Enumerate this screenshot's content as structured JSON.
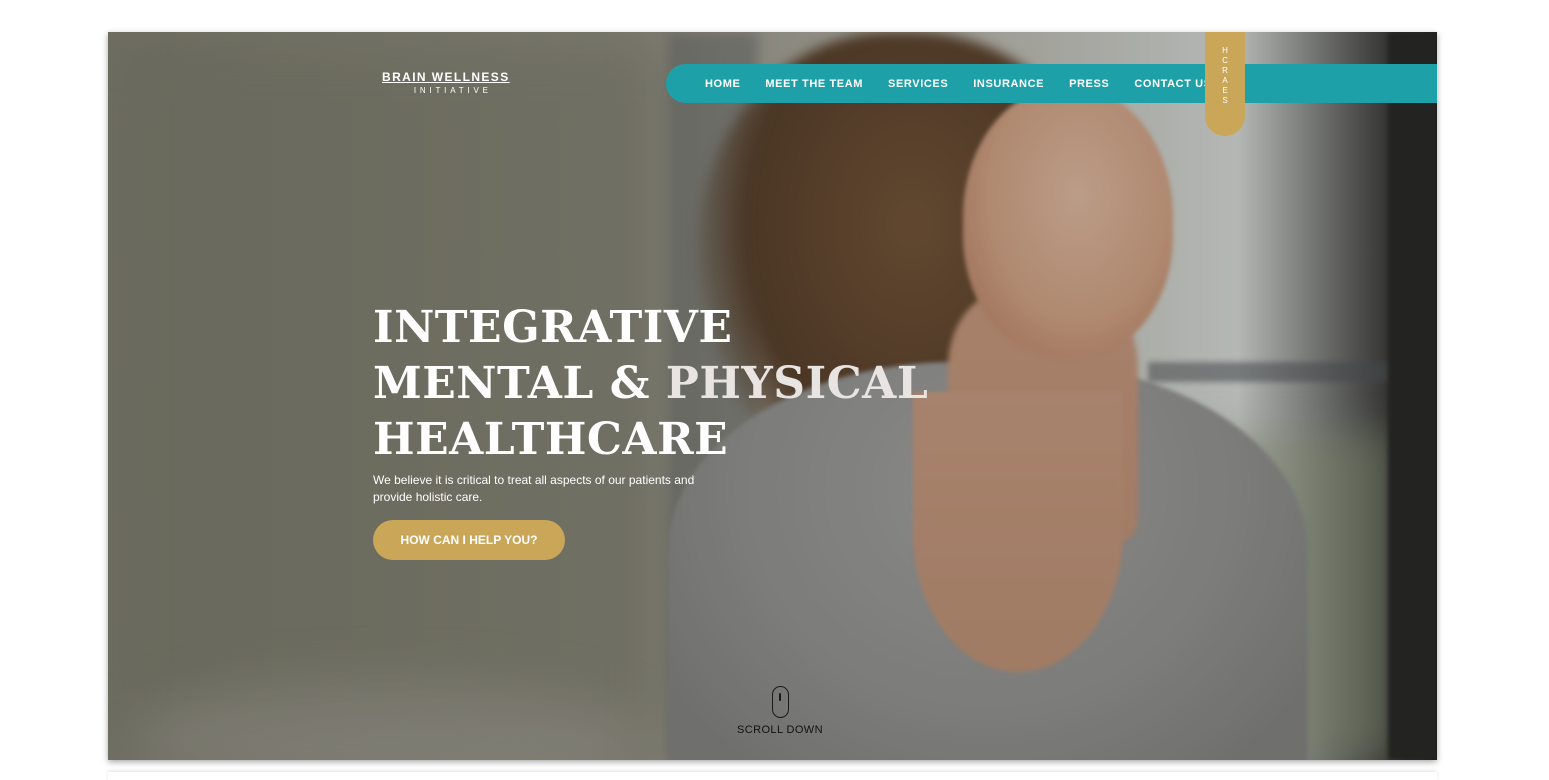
{
  "brand": {
    "name": "BRAIN WELLNESS",
    "tagline": "INITIATIVE"
  },
  "nav": {
    "items": [
      "HOME",
      "MEET THE TEAM",
      "SERVICES",
      "INSURANCE",
      "PRESS",
      "CONTACT US"
    ]
  },
  "search": {
    "letters": [
      "H",
      "C",
      "R",
      "A",
      "E",
      "S"
    ]
  },
  "hero": {
    "line1": "INTEGRATIVE",
    "line2a": "MENTAL & ",
    "line2b": "PHYSICAL",
    "line3": "HEALTHCARE",
    "subtext": "We believe it is critical to treat all aspects of our patients and provide holistic care.",
    "cta_label": "HOW CAN I HELP YOU?"
  },
  "scroll": {
    "label": "SCROLL DOWN"
  },
  "colors": {
    "teal": "#1ea0a8",
    "gold": "#c9a658"
  }
}
